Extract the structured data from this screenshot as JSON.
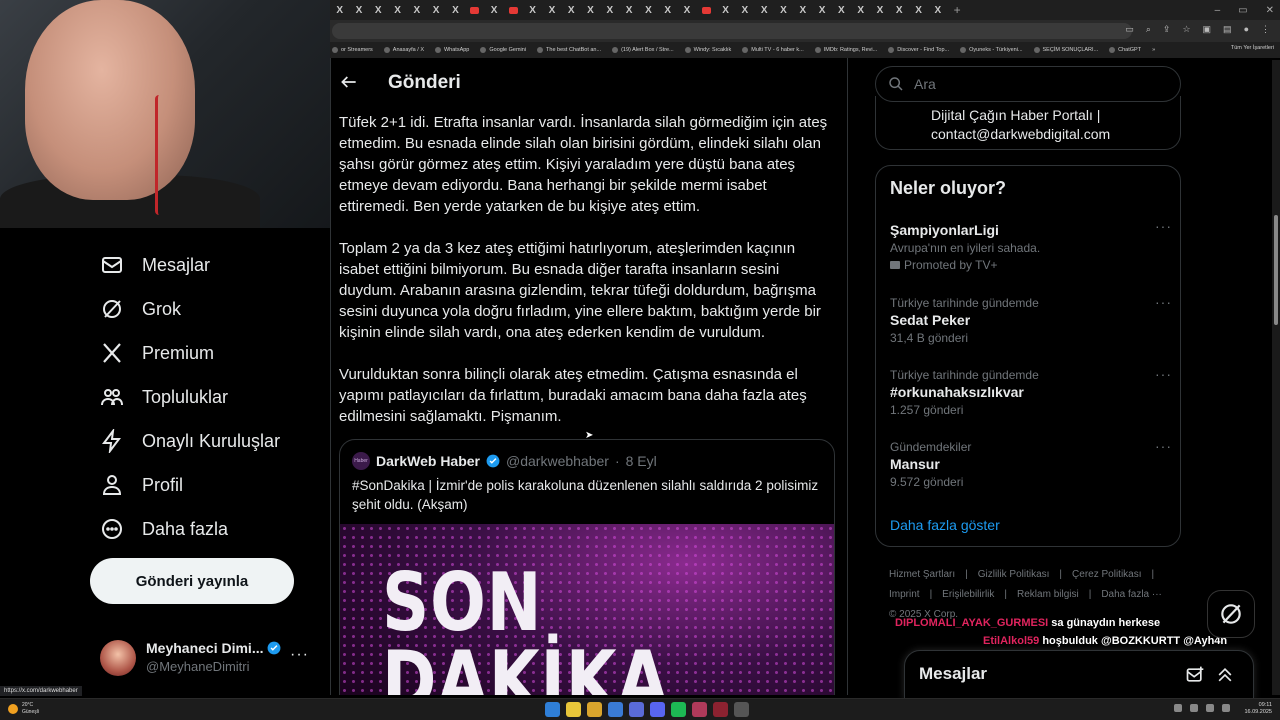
{
  "browser": {
    "tab_glyph": "X",
    "new_tab": "+",
    "window_controls": [
      "–",
      "▭",
      "✕"
    ],
    "bookmarks": [
      "or Streamers",
      "Anasayfa / X",
      "WhatsApp",
      "Google Gemini",
      "The best ChatBot an...",
      "(19) Alert Box / Stre...",
      "Windy: Sıcaklık",
      "Multi TV - 6 haber k...",
      "IMDb: Ratings, Revi...",
      "Discover - Find Top...",
      "Oyuneks - Türkiyeni...",
      "SEÇİM SONUÇLARI...",
      "ChatGPT"
    ],
    "bookmarks_more": "»",
    "all_bookmarks": "Tüm Yer İşaretleri"
  },
  "nav": {
    "items": [
      {
        "label": "Mesajlar",
        "icon": "envelope-icon"
      },
      {
        "label": "Grok",
        "icon": "grok-icon"
      },
      {
        "label": "Premium",
        "icon": "x-logo-icon"
      },
      {
        "label": "Topluluklar",
        "icon": "communities-icon"
      },
      {
        "label": "Onaylı Kuruluşlar",
        "icon": "lightning-icon"
      },
      {
        "label": "Profil",
        "icon": "person-icon"
      },
      {
        "label": "Daha fazla",
        "icon": "more-circle-icon"
      }
    ],
    "post_button": "Gönderi yayınla",
    "profile": {
      "name": "Meyhaneci Dimi...",
      "handle": "@MeyhaneDimitri",
      "more": "···"
    }
  },
  "main": {
    "title": "Gönderi",
    "paragraphs": [
      "Tüfek 2+1 idi. Etrafta insanlar vardı. İnsanlarda silah görmediğim için ateş etmedim. Bu esnada elinde silah olan birisini gördüm, elindeki silahı olan şahsı görür görmez ateş ettim. Kişiyi yaraladım yere düştü bana ateş etmeye devam ediyordu. Bana herhangi bir şekilde mermi isabet ettiremedi. Ben yerde yatarken de bu kişiye ateş ettim.",
      "Toplam 2 ya da 3 kez ateş ettiğimi hatırlıyorum, ateşlerimden kaçının isabet ettiğini bilmiyorum. Bu esnada diğer tarafta insanların sesini duydum. Arabanın arasına gizlendim, tekrar tüfeği doldurdum, bağrışma sesini duyunca yola doğru fırladım, yine ellere baktım, baktığım yerde bir kişinin elinde silah vardı, ona ateş ederken kendim de vuruldum.",
      "Vurulduktan sonra bilinçli olarak ateş etmedim. Çatışma esnasında el yapımı patlayıcıları da fırlattım, buradaki amacım bana daha fazla ateş edilmesini sağlamaktı. Pişmanım."
    ],
    "quote": {
      "avatar_text": "Haber",
      "name": "DarkWeb Haber",
      "handle": "@darkwebhaber",
      "separator": "·",
      "date": "8 Eyl",
      "text": "#SonDakika | İzmir'de polis karakoluna düzenlenen silahlı saldırıda 2 polisimiz şehit oldu. (Akşam)",
      "image_text_line1": "SON",
      "image_text_line2": "DAKİKA"
    }
  },
  "right": {
    "search_placeholder": "Ara",
    "profile_bio_line1": "Dijital Çağın Haber Portalı |",
    "profile_bio_line2": "contact@darkwebdigital.com",
    "trends_title": "Neler oluyor?",
    "trends": [
      {
        "context": "",
        "name": "ŞampiyonlarLigi",
        "sub": "Avrupa'nın en iyileri sahada.",
        "count": "",
        "promoted": "Promoted by TV+"
      },
      {
        "context": "Türkiye tarihinde gündemde",
        "name": "Sedat Peker",
        "sub": "",
        "count": "31,4 B gönderi",
        "promoted": ""
      },
      {
        "context": "Türkiye tarihinde gündemde",
        "name": "#orkunahaksızlıkvar",
        "sub": "",
        "count": "1.257 gönderi",
        "promoted": ""
      },
      {
        "context": "Gündemdekiler",
        "name": "Mansur",
        "sub": "",
        "count": "9.572 gönderi",
        "promoted": ""
      }
    ],
    "show_more": "Daha fazla göster",
    "footer": {
      "line1": [
        "Hizmet Şartları",
        "|",
        "Gizlilik Politikası",
        "|",
        "Çerez Politikası",
        "|"
      ],
      "line2": [
        "Imprint",
        "|",
        "Erişilebilirlik",
        "|",
        "Reklam bilgisi",
        "|",
        "Daha fazla ···"
      ],
      "copyright": "© 2025 X Corp."
    }
  },
  "chat": [
    {
      "user": "DIPLOMALI_AYAK_GURMESI",
      "message": "sa günaydın herkese"
    },
    {
      "user": "EtilAlkol59",
      "message": "hoşbulduk @BOZKKURTT @Ayh4n"
    }
  ],
  "messages_drawer": {
    "title": "Mesajlar"
  },
  "status_url": "https://x.com/darkwebhaber",
  "taskbar": {
    "temperature": "20°C",
    "weather": "Güneşli",
    "time": "09:11",
    "date": "16.09.2025"
  },
  "colors": {
    "accent": "#1d9bf0",
    "chat_user": "#e0245e",
    "background": "#000000"
  }
}
